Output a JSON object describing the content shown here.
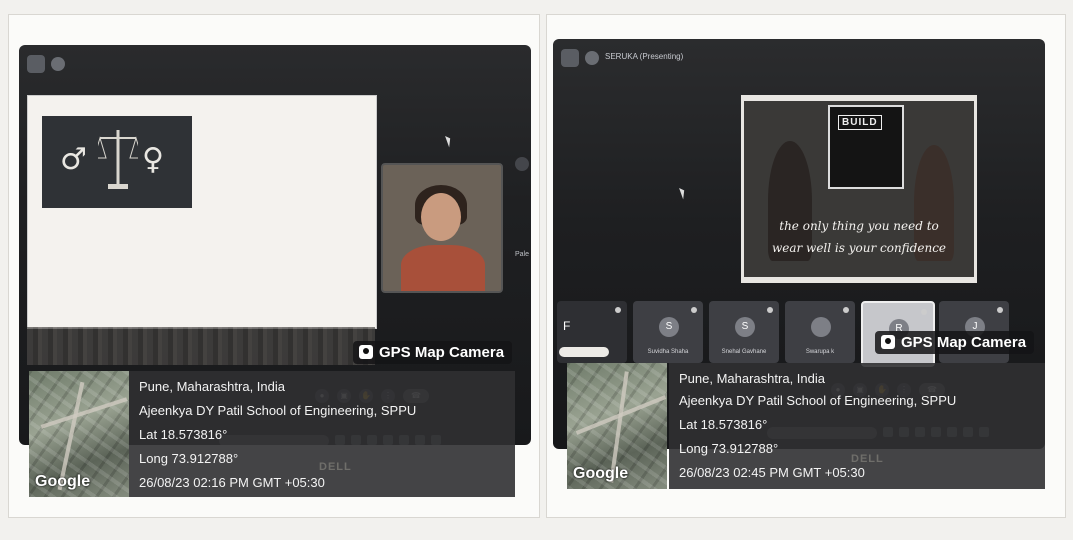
{
  "photo_1": {
    "presenter": "",
    "slide_text": "",
    "side_label": "Pale",
    "gps": {
      "title": "GPS Map Camera",
      "city": "Pune, Maharashtra, India",
      "place": "Ajeenkya DY Patil School of Engineering, SPPU",
      "lat": "Lat 18.573816°",
      "long": "Long 73.912788°",
      "datetime": "26/08/23 02:16 PM GMT +05:30",
      "map_provider": "Google"
    },
    "brand": "DELL"
  },
  "photo_2": {
    "presenter": "SERUKA (Presenting)",
    "video": {
      "logo": "BUILD",
      "caption_1": "the only thing you need to",
      "caption_2": "wear well is your confidence"
    },
    "participants": [
      {
        "initial": "F",
        "name": ""
      },
      {
        "initial": "S",
        "name": "Suvidha Shaha"
      },
      {
        "initial": "S",
        "name": "Snehal Gavhane"
      },
      {
        "initial": "",
        "name": "Swarupa k"
      },
      {
        "initial": "R",
        "name": ""
      },
      {
        "initial": "J",
        "name": ""
      }
    ],
    "gps": {
      "title": "GPS Map Camera",
      "city": "Pune, Maharashtra, India",
      "place": "Ajeenkya DY Patil School of Engineering, SPPU",
      "lat": "Lat 18.573816°",
      "long": "Long 73.912788°",
      "datetime": "26/08/23 02:45 PM GMT +05:30",
      "map_provider": "Google"
    },
    "brand": "DELL"
  },
  "colors": {
    "screen_bg": "#1b1c1e",
    "overlay_bg": "#303032",
    "overlay_text": "#f3f3f3"
  },
  "icons": [
    "male-symbol-icon",
    "female-symbol-icon",
    "scale-icon",
    "map-pin-icon",
    "mic-icon",
    "hand-raise-icon",
    "end-call-icon"
  ]
}
